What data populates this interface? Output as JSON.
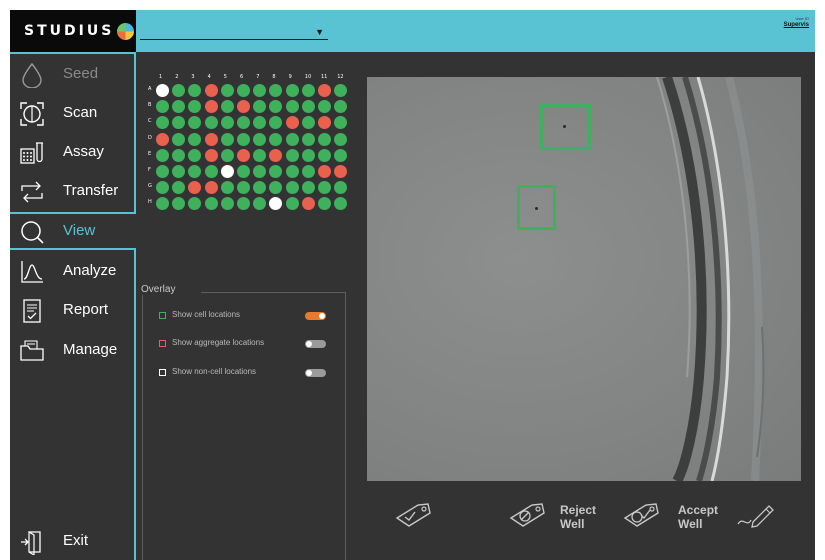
{
  "app": {
    "logo_text": "STUDIUS"
  },
  "header": {
    "experiment_value": "",
    "user_caption": "User ID",
    "user_name": "Supervis"
  },
  "sidebar": {
    "items": [
      {
        "label": "Seed",
        "icon": "drop-icon",
        "state": "disabled"
      },
      {
        "label": "Scan",
        "icon": "scan-icon",
        "state": "normal"
      },
      {
        "label": "Assay",
        "icon": "assay-icon",
        "state": "normal"
      },
      {
        "label": "Transfer",
        "icon": "transfer-icon",
        "state": "normal"
      },
      {
        "label": "View",
        "icon": "search-icon",
        "state": "active"
      },
      {
        "label": "Analyze",
        "icon": "analyze-icon",
        "state": "normal"
      },
      {
        "label": "Report",
        "icon": "report-icon",
        "state": "normal"
      },
      {
        "label": "Manage",
        "icon": "folder-icon",
        "state": "normal"
      }
    ],
    "exit_label": "Exit"
  },
  "plate": {
    "columns": [
      "1",
      "2",
      "3",
      "4",
      "5",
      "6",
      "7",
      "8",
      "9",
      "10",
      "11",
      "12"
    ],
    "rows": [
      "A",
      "B",
      "C",
      "D",
      "E",
      "F",
      "G",
      "H"
    ],
    "wells": [
      "WGGRGGGGGGRG",
      "GGGRGRGGGGGG",
      "GGGGGGGGRGRG",
      "RGGRGGGGGGGG",
      "GGGRGRGRGGGG",
      "GGGGWGGGGGRR",
      "GGRRGGGGGGGG",
      "GGGGGGGWGRGG"
    ],
    "well_colors": {
      "G": "#3fb05c",
      "R": "#e8614f",
      "W": "#ffffff"
    }
  },
  "overlay": {
    "title": "Overlay",
    "options": [
      {
        "label": "Show cell locations",
        "color": "#3fb05c",
        "on": true
      },
      {
        "label": "Show aggregate locations",
        "color": "#e8614f",
        "on": false
      },
      {
        "label": "Show non-cell locations",
        "color": "#ffffff",
        "on": false
      }
    ]
  },
  "actions": {
    "reject_line1": "Reject",
    "reject_line2": "Well",
    "accept_line1": "Accept",
    "accept_line2": "Well"
  },
  "colors": {
    "accent": "#5ac3d3",
    "sidebar_bg": "#333333",
    "toggle_on": "#e87a2e",
    "toggle_off": "#9a9a9a",
    "detection": "#3fb05c"
  }
}
